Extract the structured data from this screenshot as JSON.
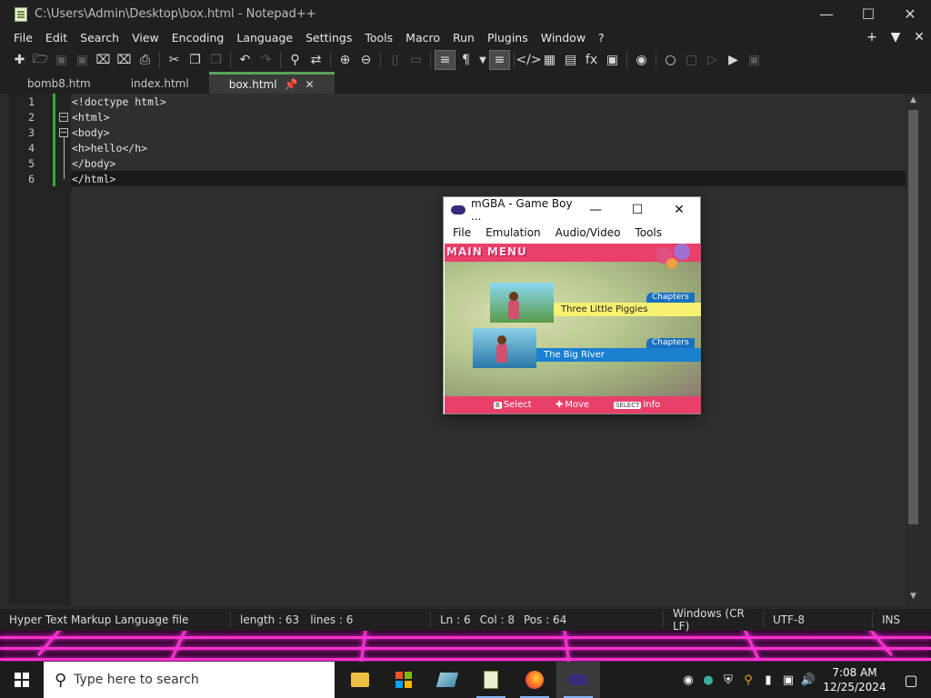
{
  "npp": {
    "title": "C:\\Users\\Admin\\Desktop\\box.html - Notepad++",
    "menu": [
      "File",
      "Edit",
      "Search",
      "View",
      "Encoding",
      "Language",
      "Settings",
      "Tools",
      "Macro",
      "Run",
      "Plugins",
      "Window",
      "?"
    ],
    "tabs": [
      {
        "label": "bomb8.htm"
      },
      {
        "label": "index.html"
      },
      {
        "label": "box.html"
      }
    ],
    "lines": [
      {
        "n": "1",
        "code": "<!doctype html>"
      },
      {
        "n": "2",
        "code": "<html>"
      },
      {
        "n": "3",
        "code": "<body>"
      },
      {
        "n": "4",
        "code": "<h>hello</h>"
      },
      {
        "n": "5",
        "code": "</body>"
      },
      {
        "n": "6",
        "code": "</html>"
      }
    ],
    "status": {
      "filetype": "Hyper Text Markup Language file",
      "length": "length : 63",
      "lines": "lines : 6",
      "ln": "Ln : 6",
      "col": "Col : 8",
      "pos": "Pos : 64",
      "eol": "Windows (CR LF)",
      "encoding": "UTF-8",
      "mode": "INS"
    }
  },
  "mgba": {
    "title": "mGBA - Game Boy ...",
    "menu": [
      "File",
      "Emulation",
      "Audio/Video",
      "Tools"
    ],
    "game": {
      "header": "MAIN MENU",
      "chapter_tag": "Chapters",
      "chapter1": "Three Little Piggies",
      "chapter2": "The Big River",
      "hint_select": "Select",
      "hint_move": "Move",
      "hint_info_badge": "SELECT",
      "hint_info": "Info",
      "b_badge": "B"
    }
  },
  "taskbar": {
    "search_placeholder": "Type here to search",
    "time": "7:08 AM",
    "date": "12/25/2024"
  }
}
